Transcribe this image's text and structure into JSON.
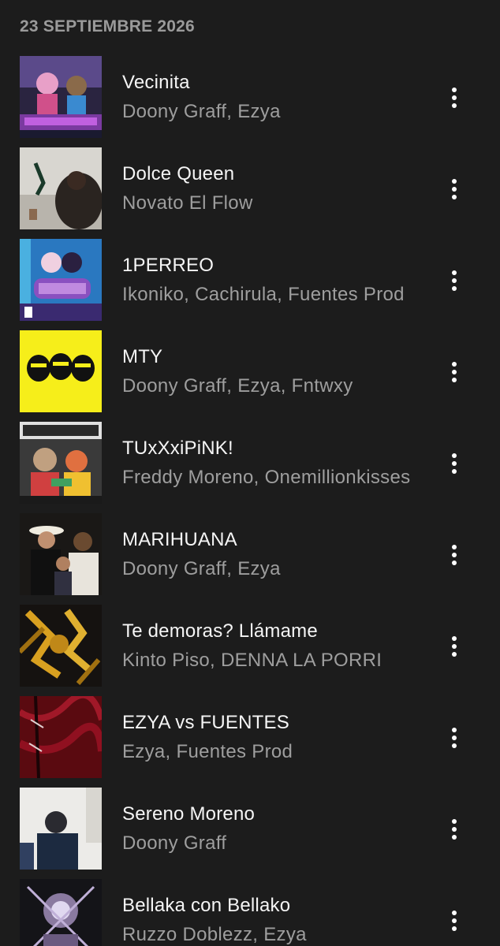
{
  "header": {
    "date": "23 SEPTIEMBRE 2026"
  },
  "tracks": [
    {
      "title": "Vecinita",
      "artist": "Doony Graff, Ezya"
    },
    {
      "title": "Dolce Queen",
      "artist": "Novato El Flow"
    },
    {
      "title": "1PERREO",
      "artist": "Ikoniko, Cachirula, Fuentes Prod"
    },
    {
      "title": "MTY",
      "artist": "Doony Graff, Ezya, Fntwxy"
    },
    {
      "title": "TUxXxiPiNK!",
      "artist": "Freddy Moreno, Onemillionkisses"
    },
    {
      "title": "MARIHUANA",
      "artist": "Doony Graff, Ezya"
    },
    {
      "title": "Te demoras? Llámame",
      "artist": "Kinto Piso, DENNA LA PORRI"
    },
    {
      "title": "EZYA vs FUENTES",
      "artist": "Ezya, Fuentes Prod"
    },
    {
      "title": "Sereno Moreno",
      "artist": "Doony Graff"
    },
    {
      "title": "Bellaka con Bellako",
      "artist": "Ruzzo Doblezz, Ezya"
    }
  ],
  "icons": {
    "more": "more-vert-icon"
  }
}
